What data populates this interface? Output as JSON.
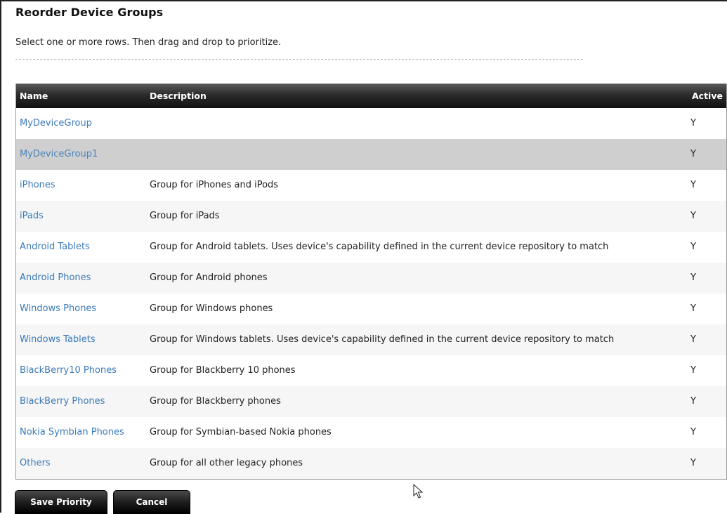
{
  "page": {
    "title": "Reorder Device Groups",
    "instruction": "Select one or more rows. Then drag and drop to prioritize."
  },
  "table": {
    "columns": {
      "name": "Name",
      "description": "Description",
      "active": "Active"
    },
    "rows": [
      {
        "name": "MyDeviceGroup",
        "description": "",
        "active": "Y",
        "selected": false
      },
      {
        "name": "MyDeviceGroup1",
        "description": "",
        "active": "Y",
        "selected": true
      },
      {
        "name": "iPhones",
        "description": "Group for iPhones and iPods",
        "active": "Y",
        "selected": false
      },
      {
        "name": "iPads",
        "description": "Group for iPads",
        "active": "Y",
        "selected": false
      },
      {
        "name": "Android Tablets",
        "description": "Group for Android tablets. Uses device's capability defined in the current device repository to match",
        "active": "Y",
        "selected": false
      },
      {
        "name": "Android Phones",
        "description": "Group for Android phones",
        "active": "Y",
        "selected": false
      },
      {
        "name": "Windows Phones",
        "description": "Group for Windows phones",
        "active": "Y",
        "selected": false
      },
      {
        "name": "Windows Tablets",
        "description": "Group for Windows tablets. Uses device's capability defined in the current device repository to match",
        "active": "Y",
        "selected": false
      },
      {
        "name": "BlackBerry10 Phones",
        "description": "Group for Blackberry 10 phones",
        "active": "Y",
        "selected": false
      },
      {
        "name": "BlackBerry Phones",
        "description": "Group for Blackberry phones",
        "active": "Y",
        "selected": false
      },
      {
        "name": "Nokia Symbian Phones",
        "description": "Group for Symbian-based Nokia phones",
        "active": "Y",
        "selected": false
      },
      {
        "name": "Others",
        "description": "Group for all other legacy phones",
        "active": "Y",
        "selected": false
      }
    ]
  },
  "actions": {
    "save_label": "Save Priority",
    "cancel_label": "Cancel"
  },
  "colors": {
    "link": "#3b7ab8",
    "selected_row": "#cfcfcf",
    "header_bg": "#1a1a1a"
  },
  "icons": {
    "cursor": "mouse-pointer-icon"
  }
}
